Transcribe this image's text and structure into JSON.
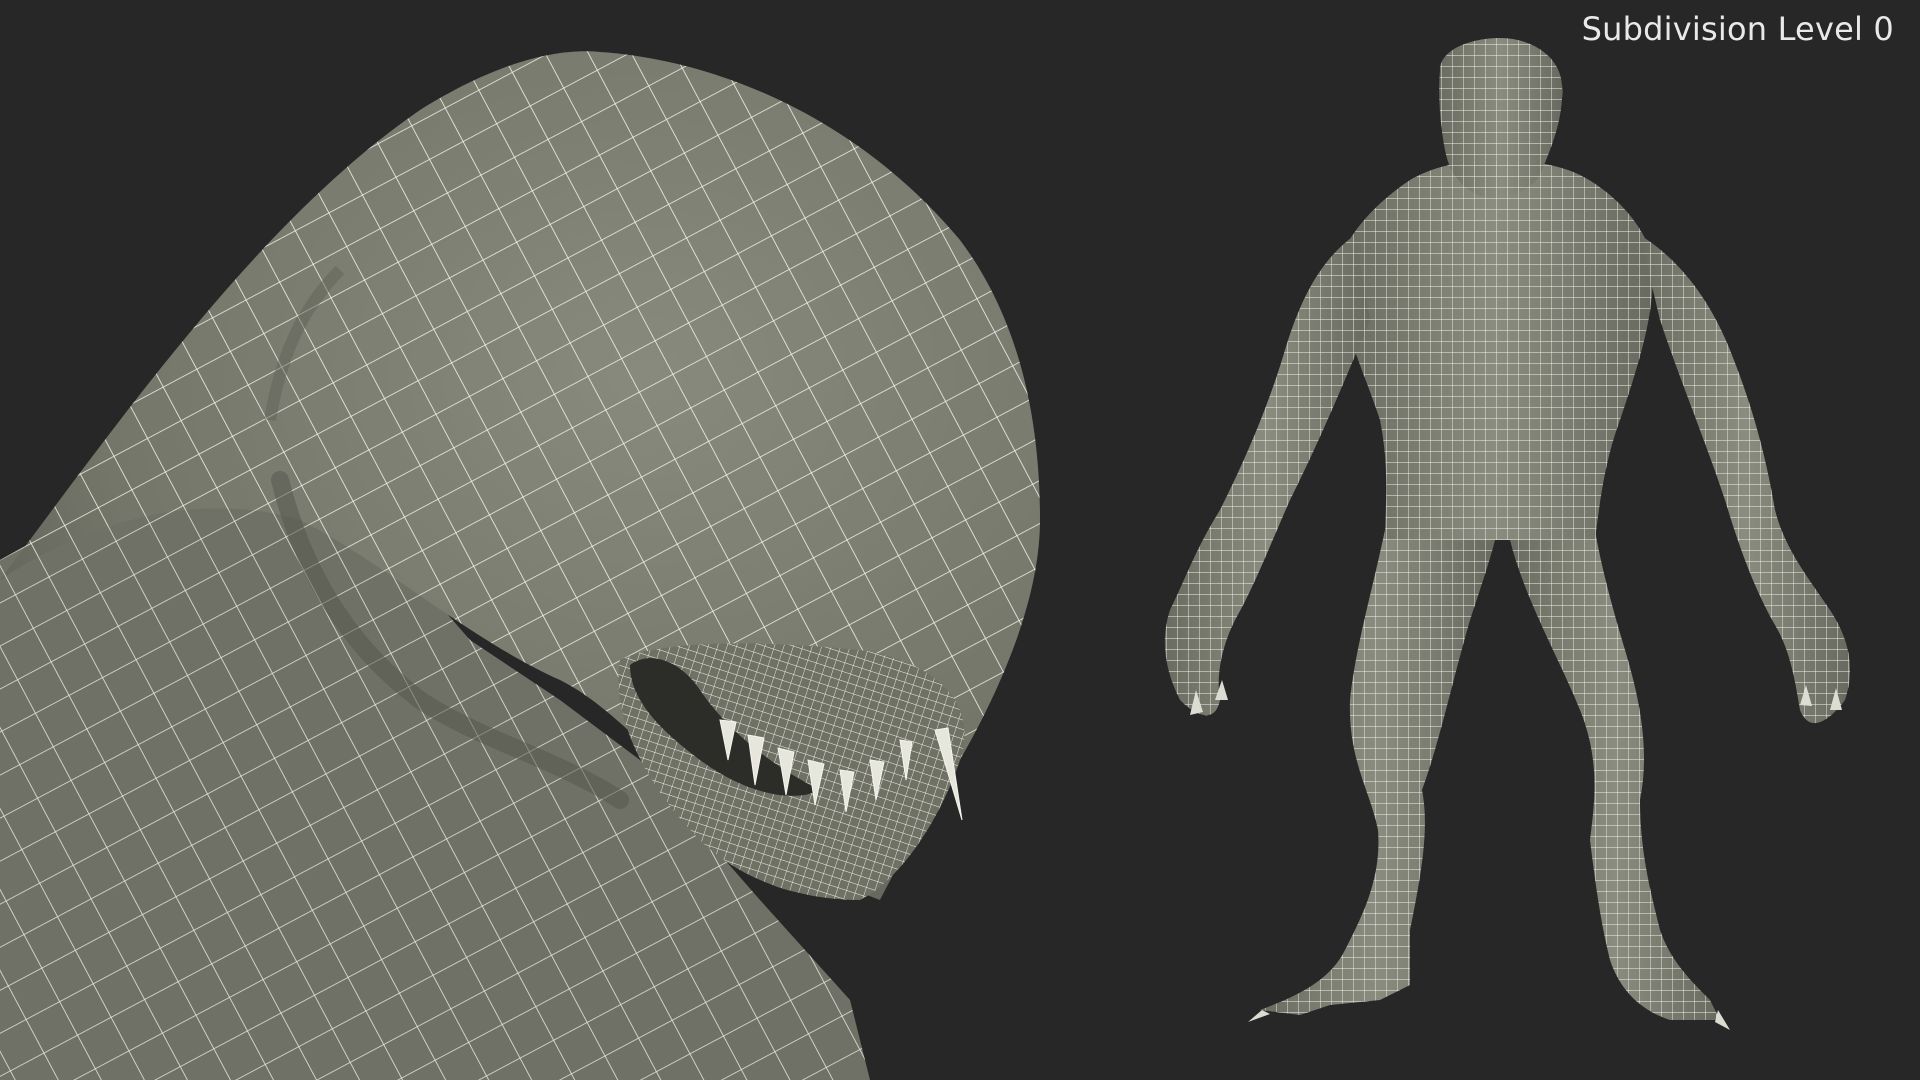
{
  "caption": {
    "label": "Subdivision Level 0"
  },
  "colors": {
    "background": "#272727",
    "surface": "#7c7e71",
    "surface_shadow": "#5b5d53",
    "wire": "#f2f2ea",
    "caption_text": "#e9e9e9"
  },
  "scene": {
    "left_view": "head-closeup-wireframe",
    "right_view": "full-body-wireframe"
  }
}
